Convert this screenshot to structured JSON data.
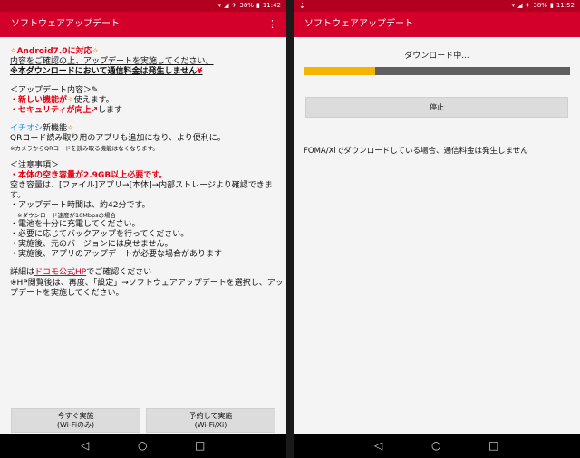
{
  "screen_a": {
    "status": {
      "battery": "38%",
      "time": "11:42"
    },
    "app_title": "ソフトウェアアップデート",
    "lines": {
      "l1": "Android7.0に対応",
      "l2": "内容をご確認の上、アップデートを実施してください。",
      "l3": "※本ダウンロードにおいて通信料金は発生しません",
      "h_update": "＜アップデート内容＞",
      "new_feature": "・新しい機能が",
      "new_feature_tail": "使えます。",
      "security": "・セキュリティが向上",
      "security_tail": "します",
      "ichioshi": "イチオシ",
      "ichioshi_tail": "新機能",
      "qr": "QRコード読み取り用のアプリも追加になり、より便利に。",
      "qr_note": "※カメラからQRコードを読み取る機能はなくなります。",
      "h_notes": "＜注意事項＞",
      "storage": "・本体の空き容量が2.9GB以上必要です。",
      "storage_check1": "空き容量は、[ファイル]アプリ→[本体]→内部ストレージより確認できま",
      "storage_check2": "す。",
      "time": "・アップデート時間は、約42分です。",
      "time_note": "※ダウンロード速度が10Mbpsの場合",
      "battery": "・電池を十分に充電してください。",
      "backup": "・必要に応じてバックアップを行ってください。",
      "revert": "・実施後、元のバージョンには戻せません。",
      "apps": "・実施後、アプリのアップデートが必要な場合があります",
      "detail_pre": "詳細は",
      "detail_link": "ドコモ公式HP",
      "detail_post": "でご確認ください",
      "hp1": "※HP閲覧後は、再度、「設定」→ソフトウェアアップデートを選択し、アッ",
      "hp2": "プデートを実施してください。"
    },
    "buttons": {
      "now_l1": "今すぐ実施",
      "now_l2": "(Wi-Fiのみ)",
      "sched_l1": "予約して実施",
      "sched_l2": "(Wi-Fi/Xi)"
    }
  },
  "screen_b": {
    "status": {
      "battery": "38%",
      "time": "11:52"
    },
    "app_title": "ソフトウェアアップデート",
    "downloading": "ダウンロード中...",
    "progress": 0.27,
    "stop_label": "停止",
    "note": "FOMA/Xiでダウンロードしている場合、通信料金は発生しません"
  },
  "icons": {
    "wifi": "wifi-icon",
    "signal": "signal-icon",
    "battery": "battery-icon"
  },
  "colors": {
    "appbar": "#d2002a",
    "statusbar": "#b30020",
    "progress": "#f5b400",
    "accent_red": "#e60012"
  }
}
